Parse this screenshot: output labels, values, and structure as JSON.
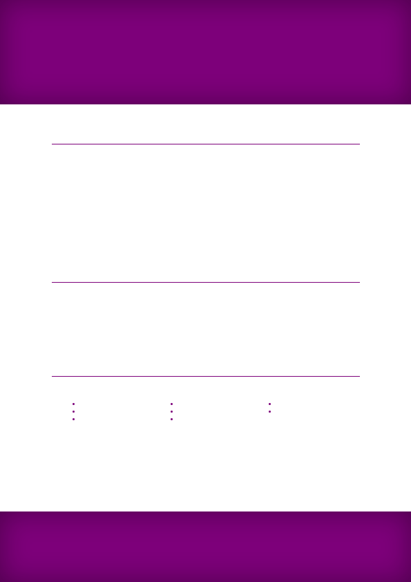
{
  "colors": {
    "accent": "#7d007a",
    "background": "#ffffff"
  },
  "columns": [
    {
      "items": [
        "",
        "",
        ""
      ]
    },
    {
      "items": [
        "",
        "",
        ""
      ]
    },
    {
      "items": [
        "",
        ""
      ]
    }
  ]
}
